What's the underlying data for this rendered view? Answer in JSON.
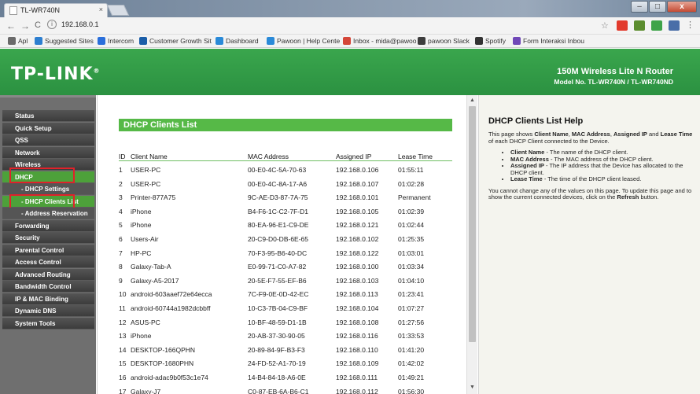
{
  "browser": {
    "tab_title": "TL-WR740N",
    "tab_close": "×",
    "url": "192.168.0.1",
    "nav": {
      "back": "←",
      "forward": "→",
      "reload": "C",
      "info": "i"
    },
    "window_buttons": {
      "minimize": "–",
      "maximize": "□",
      "close": "x"
    },
    "bookmarks": [
      {
        "label": "Apl",
        "icon": "apps-grid-icon",
        "color": "#6a6a6a"
      },
      {
        "label": "Suggested Sites",
        "icon": "bing-icon",
        "color": "#2d7fd0"
      },
      {
        "label": "Intercom",
        "icon": "intercom-icon",
        "color": "#2a6fdb"
      },
      {
        "label": "Customer Growth Sit",
        "icon": "doc-icon",
        "color": "#1b5ea8"
      },
      {
        "label": "Dashboard",
        "icon": "p-icon",
        "color": "#2a8ad8"
      },
      {
        "label": "Pawoon | Help Cente",
        "icon": "p-icon",
        "color": "#2a8ad8"
      },
      {
        "label": "Inbox - mida@pawoo",
        "icon": "gmail-icon",
        "color": "#d44638"
      },
      {
        "label": "pawoon Slack",
        "icon": "slack-icon",
        "color": "#3d3d3d"
      },
      {
        "label": "Spotify",
        "icon": "spotify-icon",
        "color": "#333333"
      },
      {
        "label": "Form Interaksi Inbou",
        "icon": "form-icon",
        "color": "#7048b8"
      }
    ]
  },
  "banner": {
    "logo": "TP-LINK",
    "logo_mark": "®",
    "title": "150M Wireless Lite N Router",
    "model": "Model No. TL-WR740N / TL-WR740ND"
  },
  "sidebar": {
    "items": [
      {
        "label": "Status",
        "kind": "main"
      },
      {
        "label": "Quick Setup",
        "kind": "main"
      },
      {
        "label": "QSS",
        "kind": "main"
      },
      {
        "label": "Network",
        "kind": "main"
      },
      {
        "label": "Wireless",
        "kind": "main"
      },
      {
        "label": "DHCP",
        "kind": "active"
      },
      {
        "label": "- DHCP Settings",
        "kind": "sub"
      },
      {
        "label": "- DHCP Clients List",
        "kind": "sub-active"
      },
      {
        "label": "- Address Reservation",
        "kind": "sub"
      },
      {
        "label": "Forwarding",
        "kind": "main"
      },
      {
        "label": "Security",
        "kind": "main"
      },
      {
        "label": "Parental Control",
        "kind": "main"
      },
      {
        "label": "Access Control",
        "kind": "main"
      },
      {
        "label": "Advanced Routing",
        "kind": "main"
      },
      {
        "label": "Bandwidth Control",
        "kind": "main"
      },
      {
        "label": "IP & MAC Binding",
        "kind": "main"
      },
      {
        "label": "Dynamic DNS",
        "kind": "main"
      },
      {
        "label": "System Tools",
        "kind": "main"
      }
    ]
  },
  "main": {
    "title": "DHCP Clients List",
    "headers": {
      "id": "ID",
      "name": "Client Name",
      "mac": "MAC Address",
      "ip": "Assigned IP",
      "lease": "Lease Time"
    },
    "rows": [
      {
        "id": "1",
        "name": "USER-PC",
        "mac": "00-E0-4C-5A-70-63",
        "ip": "192.168.0.106",
        "lease": "01:55:11"
      },
      {
        "id": "2",
        "name": "USER-PC",
        "mac": "00-E0-4C-8A-17-A6",
        "ip": "192.168.0.107",
        "lease": "01:02:28"
      },
      {
        "id": "3",
        "name": "Printer-877A75",
        "mac": "9C-AE-D3-87-7A-75",
        "ip": "192.168.0.101",
        "lease": "Permanent"
      },
      {
        "id": "4",
        "name": "iPhone",
        "mac": "B4-F6-1C-C2-7F-D1",
        "ip": "192.168.0.105",
        "lease": "01:02:39"
      },
      {
        "id": "5",
        "name": "iPhone",
        "mac": "80-EA-96-E1-C9-DE",
        "ip": "192.168.0.121",
        "lease": "01:02:44"
      },
      {
        "id": "6",
        "name": "Users-Air",
        "mac": "20-C9-D0-DB-6E-65",
        "ip": "192.168.0.102",
        "lease": "01:25:35"
      },
      {
        "id": "7",
        "name": "HP-PC",
        "mac": "70-F3-95-B6-40-DC",
        "ip": "192.168.0.122",
        "lease": "01:03:01"
      },
      {
        "id": "8",
        "name": "Galaxy-Tab-A",
        "mac": "E0-99-71-C0-A7-82",
        "ip": "192.168.0.100",
        "lease": "01:03:34"
      },
      {
        "id": "9",
        "name": "Galaxy-A5-2017",
        "mac": "20-5E-F7-55-EF-B6",
        "ip": "192.168.0.103",
        "lease": "01:04:10"
      },
      {
        "id": "10",
        "name": "android-603aaef72e64ecca",
        "mac": "7C-F9-0E-0D-42-EC",
        "ip": "192.168.0.113",
        "lease": "01:23:41"
      },
      {
        "id": "11",
        "name": "android-60744a1982dcbbff",
        "mac": "10-C3-7B-04-C9-BF",
        "ip": "192.168.0.104",
        "lease": "01:07:27"
      },
      {
        "id": "12",
        "name": "ASUS-PC",
        "mac": "10-BF-48-59-D1-1B",
        "ip": "192.168.0.108",
        "lease": "01:27:56"
      },
      {
        "id": "13",
        "name": "iPhone",
        "mac": "20-AB-37-30-90-05",
        "ip": "192.168.0.116",
        "lease": "01:33:53"
      },
      {
        "id": "14",
        "name": "DESKTOP-166QPHN",
        "mac": "20-89-84-9F-B3-F3",
        "ip": "192.168.0.110",
        "lease": "01:41:20"
      },
      {
        "id": "15",
        "name": "DESKTOP-1680PHN",
        "mac": "24-FD-52-A1-70-19",
        "ip": "192.168.0.109",
        "lease": "01:42:02"
      },
      {
        "id": "16",
        "name": "android-adac9b0f53c1e74",
        "mac": "14-B4-84-18-A6-0E",
        "ip": "192.168.0.111",
        "lease": "01:49:21"
      },
      {
        "id": "17",
        "name": "Galaxy-J7",
        "mac": "C0-87-EB-6A-B6-C1",
        "ip": "192.168.0.112",
        "lease": "01:56:30"
      }
    ]
  },
  "help": {
    "title": "DHCP Clients List Help",
    "intro": [
      {
        "t": "This page shows ",
        "b": false
      },
      {
        "t": "Client Name",
        "b": true
      },
      {
        "t": ", ",
        "b": false
      },
      {
        "t": "MAC Address",
        "b": true
      },
      {
        "t": ", ",
        "b": false
      },
      {
        "t": "Assigned IP",
        "b": true
      },
      {
        "t": " and ",
        "b": false
      },
      {
        "t": "Lease Time",
        "b": true
      },
      {
        "t": " of each DHCP Client connected to the Device.",
        "b": false
      }
    ],
    "items": [
      {
        "term": "Client Name",
        "desc": " - The name of the DHCP client."
      },
      {
        "term": "MAC Address",
        "desc": " - The MAC address of the DHCP client."
      },
      {
        "term": "Assigned IP",
        "desc": " - The IP address that the Device has allocated to the DHCP client."
      },
      {
        "term": "Lease Time",
        "desc": " - The time of the DHCP client leased."
      }
    ],
    "outro": [
      {
        "t": "You cannot change any of the values on this page. To update this page and to show the current connected devices, click on the ",
        "b": false
      },
      {
        "t": "Refresh",
        "b": true
      },
      {
        "t": " button.",
        "b": false
      }
    ]
  },
  "colors": {
    "brand_green": "#3aa64d",
    "menu_active": "#4da13a",
    "highlight_red": "#e0222a"
  }
}
